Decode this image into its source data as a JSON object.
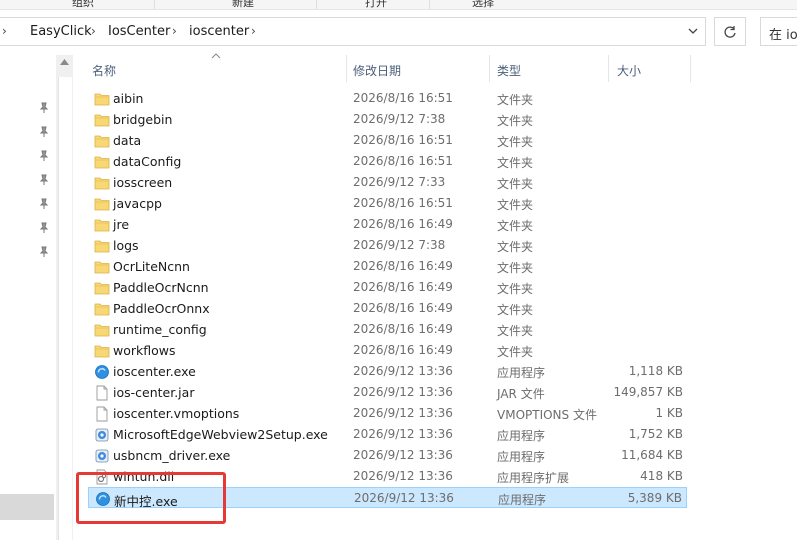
{
  "ribbon": {
    "tabs": [
      "组织",
      "新建",
      "打开",
      "选择"
    ]
  },
  "address_bar": {
    "crumbs": [
      "EasyClick",
      "IosCenter",
      "ioscenter"
    ],
    "search_text": "在 io"
  },
  "columns": {
    "name": "名称",
    "date": "修改日期",
    "type": "类型",
    "size": "大小"
  },
  "files": [
    {
      "name": "aibin",
      "date": "2026/8/16 16:51",
      "type": "文件夹",
      "size": "",
      "icon": "folder-icon"
    },
    {
      "name": "bridgebin",
      "date": "2026/9/12 7:38",
      "type": "文件夹",
      "size": "",
      "icon": "folder-icon"
    },
    {
      "name": "data",
      "date": "2026/8/16 16:51",
      "type": "文件夹",
      "size": "",
      "icon": "folder-icon"
    },
    {
      "name": "dataConfig",
      "date": "2026/8/16 16:51",
      "type": "文件夹",
      "size": "",
      "icon": "folder-icon"
    },
    {
      "name": "iosscreen",
      "date": "2026/9/12 7:33",
      "type": "文件夹",
      "size": "",
      "icon": "folder-icon"
    },
    {
      "name": "javacpp",
      "date": "2026/8/16 16:51",
      "type": "文件夹",
      "size": "",
      "icon": "folder-icon"
    },
    {
      "name": "jre",
      "date": "2026/8/16 16:49",
      "type": "文件夹",
      "size": "",
      "icon": "folder-icon"
    },
    {
      "name": "logs",
      "date": "2026/9/12 7:38",
      "type": "文件夹",
      "size": "",
      "icon": "folder-icon"
    },
    {
      "name": "OcrLiteNcnn",
      "date": "2026/8/16 16:49",
      "type": "文件夹",
      "size": "",
      "icon": "folder-icon"
    },
    {
      "name": "PaddleOcrNcnn",
      "date": "2026/8/16 16:49",
      "type": "文件夹",
      "size": "",
      "icon": "folder-icon"
    },
    {
      "name": "PaddleOcrOnnx",
      "date": "2026/8/16 16:49",
      "type": "文件夹",
      "size": "",
      "icon": "folder-icon"
    },
    {
      "name": "runtime_config",
      "date": "2026/8/16 16:49",
      "type": "文件夹",
      "size": "",
      "icon": "folder-icon"
    },
    {
      "name": "workflows",
      "date": "2026/8/16 16:49",
      "type": "文件夹",
      "size": "",
      "icon": "folder-icon"
    },
    {
      "name": "ioscenter.exe",
      "date": "2026/9/12 13:36",
      "type": "应用程序",
      "size": "1,118 KB",
      "icon": "app-icon"
    },
    {
      "name": "ios-center.jar",
      "date": "2026/9/12 13:36",
      "type": "JAR 文件",
      "size": "149,857 KB",
      "icon": "file-icon"
    },
    {
      "name": "ioscenter.vmoptions",
      "date": "2026/9/12 13:36",
      "type": "VMOPTIONS 文件",
      "size": "1 KB",
      "icon": "file-icon"
    },
    {
      "name": "MicrosoftEdgeWebview2Setup.exe",
      "date": "2026/9/12 13:36",
      "type": "应用程序",
      "size": "1,752 KB",
      "icon": "installer-icon"
    },
    {
      "name": "usbncm_driver.exe",
      "date": "2026/9/12 13:36",
      "type": "应用程序",
      "size": "11,684 KB",
      "icon": "installer-icon"
    },
    {
      "name": "wintun.dll",
      "date": "2026/9/12 13:36",
      "type": "应用程序扩展",
      "size": "418 KB",
      "icon": "dll-icon"
    },
    {
      "name": "新中控.exe",
      "date": "2026/9/12 13:36",
      "type": "应用程序",
      "size": "5,389 KB",
      "icon": "app-icon",
      "selected": true
    }
  ],
  "colors": {
    "selection_bg": "#cce8ff",
    "selection_border": "#99d1ff",
    "highlight": "#e53935"
  }
}
